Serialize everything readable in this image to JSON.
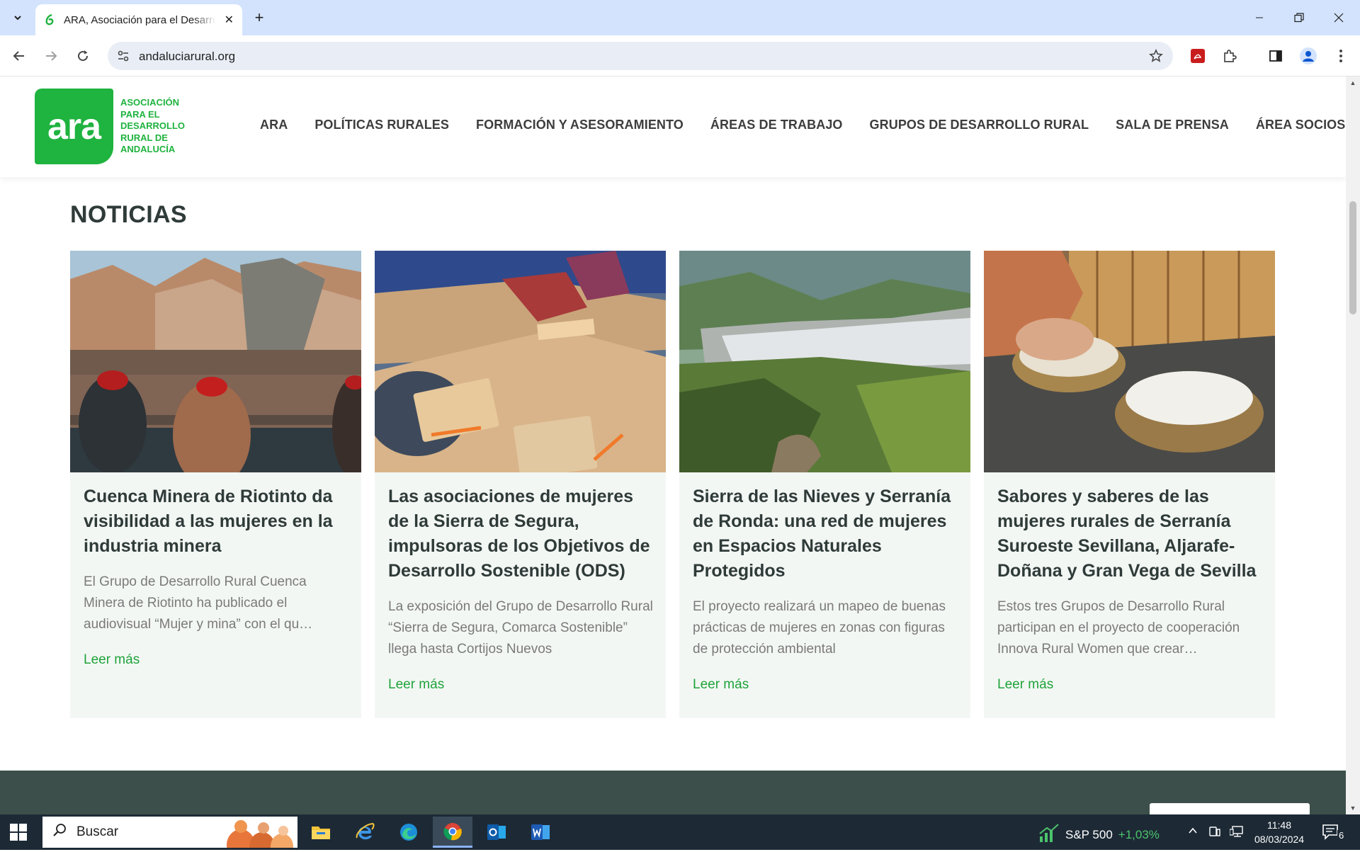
{
  "browser": {
    "tab_title": "ARA, Asociación para el Desarrollo Rural de Andalucía",
    "url": "andaluciarural.org"
  },
  "site": {
    "logo_word": "ara",
    "logo_text": "ASOCIACIÓN PARA EL DESARROLLO RURAL DE ANDALUCÍA",
    "nav": [
      "ARA",
      "POLÍTICAS RURALES",
      "FORMACIÓN Y ASESORAMIENTO",
      "ÁREAS DE TRABAJO",
      "GRUPOS DE DESARROLLO RURAL",
      "SALA DE PRENSA",
      "ÁREA SOCIOS"
    ],
    "section_title": "NOTICIAS",
    "cards": [
      {
        "title": "Cuenca Minera de Riotinto da visibilidad a las mujeres en la industria minera",
        "excerpt": "El Grupo de Desarrollo Rural Cuenca Minera de Riotinto ha publicado el audiovisual “Mujer y mina” con el qu…",
        "link": "Leer más"
      },
      {
        "title": "Las asociaciones de mujeres de la Sierra de Segura, impulsoras de los Objetivos de Desarrollo Sostenible (ODS)",
        "excerpt": "La exposición del Grupo de Desarrollo Rural “Sierra de Segura, Comarca Sostenible” llega hasta Cortijos Nuevos",
        "link": "Leer más"
      },
      {
        "title": "Sierra de las Nieves y Serranía de Ronda: una red de mujeres en Espacios Naturales Protegidos",
        "excerpt": "El proyecto realizará un mapeo de buenas prácticas de mujeres en zonas con figuras de protección ambiental",
        "link": "Leer más"
      },
      {
        "title": "Sabores y saberes de las mujeres rurales de Serranía Suroeste Sevillana, Aljarafe-Doñana y Gran Vega de Sevilla",
        "excerpt": "Estos tres Grupos de Desarrollo Rural participan en el proyecto de cooperación Innova Rural Women que crear…",
        "link": "Leer más"
      }
    ]
  },
  "taskbar": {
    "search_placeholder": "Buscar",
    "stock_name": "S&P 500",
    "stock_change": "+1,03%",
    "time": "11:48",
    "date": "08/03/2024",
    "notification_count": "6"
  },
  "icons": {
    "tab_search": "chevron-down-icon",
    "favicon": "ara-favicon-icon",
    "close": "close-icon",
    "new_tab": "plus-icon",
    "back": "arrow-left-icon",
    "forward": "arrow-right-icon",
    "reload": "reload-icon",
    "site_info": "tune-icon",
    "bookmark": "star-icon",
    "pdf": "pdf-icon",
    "extensions": "puzzle-icon",
    "side_panel": "side-panel-icon",
    "profile": "profile-icon",
    "menu": "kebab-menu-icon"
  },
  "colors": {
    "brand_green": "#1fb33f",
    "link_green": "#1fa33a",
    "footer": "#3c4f4a",
    "chrome_tabstrip": "#d3e3fd"
  }
}
